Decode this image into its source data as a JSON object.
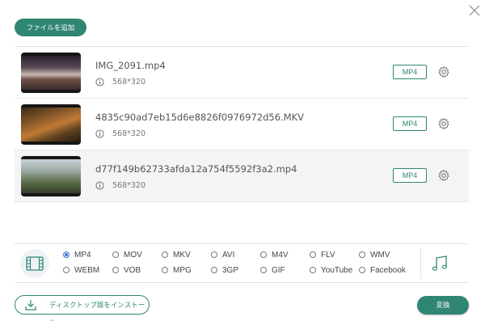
{
  "toolbar": {
    "add_files_label": "ファイルを追加"
  },
  "files": [
    {
      "name": "IMG_2091.mp4",
      "resolution": "568*320",
      "format": "MP4"
    },
    {
      "name": "4835c90ad7eb15d6e8826f0976972d56.MKV",
      "resolution": "568*320",
      "format": "MP4"
    },
    {
      "name": "d77f149b62733afda12a754f5592f3a2.mp4",
      "resolution": "568*320",
      "format": "MP4"
    }
  ],
  "formats": {
    "selected": "MP4",
    "row1": [
      "MP4",
      "MOV",
      "MKV",
      "AVI",
      "M4V",
      "FLV",
      "WMV"
    ],
    "row2": [
      "WEBM",
      "VOB",
      "MPG",
      "3GP",
      "GIF",
      "YouTube",
      "Facebook"
    ]
  },
  "footer": {
    "install_label": "ディスクトップ版をインストール",
    "convert_label": "変換"
  },
  "colors": {
    "accent": "#2f8673",
    "radio_selected": "#3a6fd8"
  },
  "icons": [
    "close-icon",
    "info-icon",
    "gear-icon",
    "video-file-icon",
    "music-note-icon",
    "download-icon"
  ]
}
